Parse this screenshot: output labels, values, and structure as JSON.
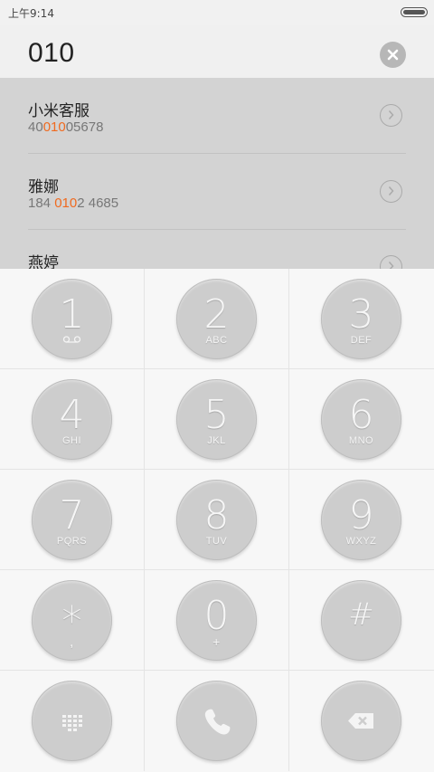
{
  "status_bar": {
    "time": "上午9:14",
    "battery_level": 1.0
  },
  "input": {
    "value": "010"
  },
  "results": [
    {
      "name": "小米客服",
      "number_parts": [
        "40",
        "010",
        "05678"
      ]
    },
    {
      "name": "雅娜",
      "number_parts": [
        "184 ",
        "010",
        "2 4685"
      ]
    },
    {
      "name": "燕婷",
      "number_parts": [
        "",
        "",
        ""
      ]
    }
  ],
  "keypad": {
    "keys": [
      {
        "digit": "1",
        "letters": "",
        "icon": "voicemail-icon"
      },
      {
        "digit": "2",
        "letters": "ABC"
      },
      {
        "digit": "3",
        "letters": "DEF"
      },
      {
        "digit": "4",
        "letters": "GHI"
      },
      {
        "digit": "5",
        "letters": "JKL"
      },
      {
        "digit": "6",
        "letters": "MNO"
      },
      {
        "digit": "7",
        "letters": "PQRS"
      },
      {
        "digit": "8",
        "letters": "TUV"
      },
      {
        "digit": "9",
        "letters": "WXYZ"
      },
      {
        "digit": "*",
        "letters": ","
      },
      {
        "digit": "0",
        "letters": "+"
      },
      {
        "digit": "#",
        "letters": ""
      }
    ],
    "actions": [
      {
        "icon": "dialpad-icon"
      },
      {
        "icon": "phone-call-icon"
      },
      {
        "icon": "backspace-icon"
      }
    ]
  },
  "colors": {
    "highlight": "#f06a1f",
    "results_bg": "#d3d3d3",
    "key_circle": "#cdcdcd"
  }
}
